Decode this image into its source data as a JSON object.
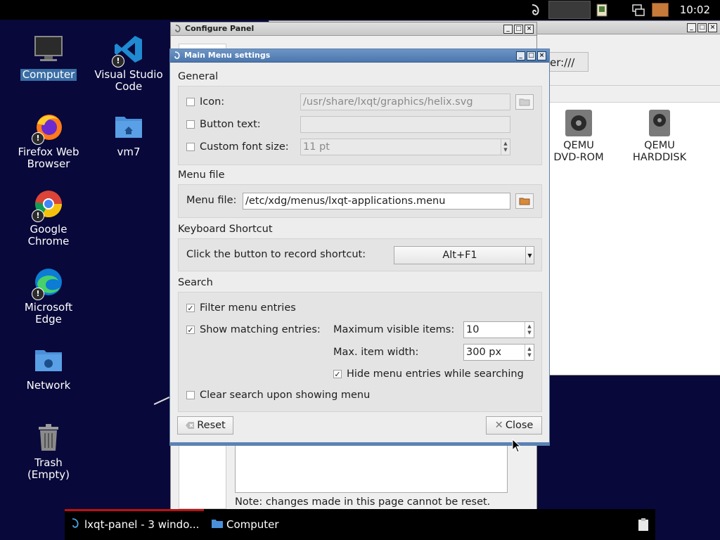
{
  "top_panel": {
    "clock": "10:02",
    "icons": [
      "lxqt-leaf-icon",
      "panel-widget-icon",
      "clipboard-note-icon",
      "network-icon",
      "volume-icon"
    ]
  },
  "desktop": {
    "icons": [
      {
        "label": "Computer",
        "icon": "monitor-icon",
        "selected": true
      },
      {
        "label": "Visual Studio Code",
        "icon": "vscode-icon"
      },
      {
        "label": "Firefox Web Browser",
        "icon": "firefox-icon"
      },
      {
        "label": "vm7",
        "icon": "home-folder-icon"
      },
      {
        "label": "Google Chrome",
        "icon": "chrome-icon"
      },
      {
        "label": "Microsoft Edge",
        "icon": "edge-icon"
      },
      {
        "label": "Network",
        "icon": "network-folder-icon"
      },
      {
        "label": "Trash (Empty)",
        "icon": "trash-icon"
      }
    ]
  },
  "file_manager": {
    "address": "er:///",
    "items": [
      {
        "label": "QEMU DVD-ROM",
        "icon": "optical-drive-icon"
      },
      {
        "label": "QEMU HARDDISK",
        "icon": "hard-disk-icon"
      }
    ]
  },
  "configure_panel": {
    "title": "Configure Panel",
    "note": "Note: changes made in this page cannot be reset."
  },
  "dialog": {
    "title": "Main Menu settings",
    "general": {
      "heading": "General",
      "icon_label": "Icon:",
      "icon_value": "/usr/share/lxqt/graphics/helix.svg",
      "button_text_label": "Button text:",
      "button_text_value": "",
      "font_size_label": "Custom font size:",
      "font_size_value": "11 pt"
    },
    "menu_file": {
      "heading": "Menu file",
      "label": "Menu file:",
      "value": "/etc/xdg/menus/lxqt-applications.menu"
    },
    "shortcut": {
      "heading": "Keyboard Shortcut",
      "label": "Click the button to record shortcut:",
      "value": "Alt+F1"
    },
    "search": {
      "heading": "Search",
      "filter_label": "Filter menu entries",
      "show_matching_label": "Show matching entries:",
      "max_visible_label": "Maximum visible items:",
      "max_visible_value": "10",
      "max_width_label": "Max. item width:",
      "max_width_value": "300 px",
      "hide_label": "Hide menu entries while searching",
      "clear_label": "Clear search upon showing menu"
    },
    "reset_label": "Reset",
    "close_label": "Close"
  },
  "taskbar": {
    "tasks": [
      {
        "label": "lxqt-panel - 3 windo...",
        "icon": "lxqt-leaf-icon"
      },
      {
        "label": "Computer",
        "icon": "folder-icon"
      }
    ]
  },
  "colors": {
    "desktop_bg": "#08083a",
    "dialog_titlebar": "#5a82b6",
    "selection": "#3a6ea5",
    "active_task_indicator": "#c01010"
  }
}
